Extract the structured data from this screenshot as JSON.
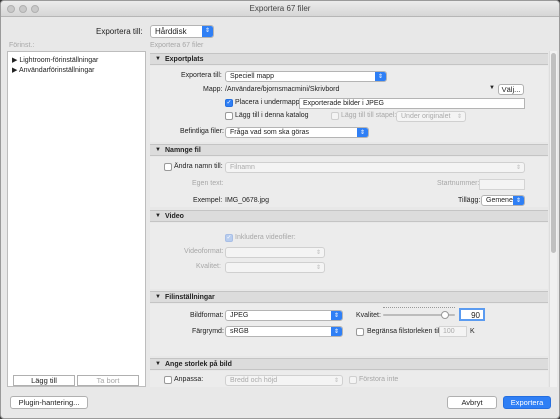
{
  "window": {
    "title": "Exportera 67 filer"
  },
  "header": {
    "export_to_label": "Exportera till:",
    "export_to_value": "Hårddisk"
  },
  "sidebar": {
    "title": "Förinst.:",
    "items": [
      {
        "label": "Lightroom-förinställningar"
      },
      {
        "label": "Användarförinställningar"
      }
    ],
    "add_label": "Lägg till",
    "remove_label": "Ta bort"
  },
  "main": {
    "title": "Exportera 67 filer"
  },
  "export_location": {
    "header": "Exportplats",
    "export_to_label": "Exportera till:",
    "export_to_value": "Speciell mapp",
    "folder_label": "Mapp:",
    "folder_path": "/Användare/bjornsmacmini/Skrivbord",
    "choose_label": "Välj...",
    "subfolder_label": "Placera i undermapp:",
    "subfolder_value": "Exporterade bilder i JPEG",
    "catalog_label": "Lägg till i denna katalog",
    "stack_label": "Lägg till till stapel:",
    "stack_value": "Under originalet",
    "existing_label": "Befintliga filer:",
    "existing_value": "Fråga vad som ska göras"
  },
  "naming": {
    "header": "Namnge fil",
    "rename_label": "Ändra namn till:",
    "rename_value": "Filnamn",
    "custom_text_label": "Egen text:",
    "start_number_label": "Startnummer:",
    "example_label": "Exempel:",
    "example_value": "IMG_0678.jpg",
    "extension_label": "Tillägg:",
    "extension_value": "Gemener"
  },
  "video": {
    "header": "Video",
    "include_label": "Inkludera videofiler:",
    "format_label": "Videoformat:",
    "quality_label": "Kvalitet:"
  },
  "file_settings": {
    "header": "Filinställningar",
    "format_label": "Bildformat:",
    "format_value": "JPEG",
    "quality_label": "Kvalitet:",
    "quality_value": "90",
    "quality_fraction": 0.9,
    "colorspace_label": "Färgrymd:",
    "colorspace_value": "sRGB",
    "limit_label": "Begränsa filstorleken till:",
    "limit_value": "100",
    "limit_unit": "K"
  },
  "resize": {
    "header": "Ange storlek på bild",
    "fit_label": "Anpassa:",
    "fit_value": "Bredd och höjd",
    "no_enlarge_label": "Förstora inte"
  },
  "footer": {
    "plugin_label": "Plugin-hantering...",
    "cancel_label": "Avbryt",
    "export_label": "Exportera"
  }
}
